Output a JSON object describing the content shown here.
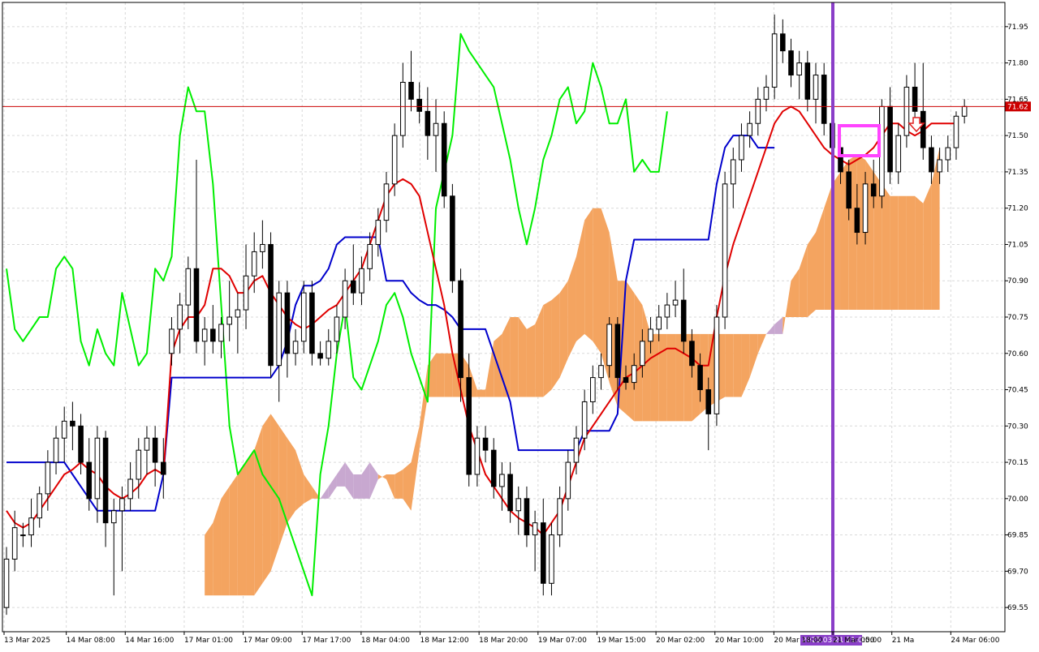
{
  "chart_data": {
    "type": "candlestick",
    "y_ticks": [
      "71.95",
      "71.80",
      "71.65",
      "71.50",
      "71.35",
      "71.20",
      "71.05",
      "70.90",
      "70.75",
      "70.60",
      "70.45",
      "70.30",
      "70.15",
      "70.00",
      "69.85",
      "69.70",
      "69.55"
    ],
    "x_ticks": [
      "13 Mar 2025",
      "14 Mar 08:00",
      "14 Mar 16:00",
      "17 Mar 01:00",
      "17 Mar 09:00",
      "17 Mar 17:00",
      "18 Mar 04:00",
      "18 Mar 12:00",
      "18 Mar 20:00",
      "19 Mar 07:00",
      "19 Mar 15:00",
      "20 Mar 02:00",
      "20 Mar 10:00",
      "20 Mar 18:00",
      "21 Mar 05:00",
      "21 Ma",
      "24 Mar 06:00"
    ],
    "time_badge": "2025.03.21 21:00",
    "time_badge_suffix": ":00",
    "current_price": "71.62",
    "grid": true,
    "price_range": [
      69.45,
      72.05
    ],
    "colors": {
      "tenkan": "#e00000",
      "kijun": "#0000cc",
      "chikou": "#00ee00",
      "chikou_overlap": "#ff5fa0",
      "cloud_bull": "#f4a460",
      "cloud_bear": "#c8a8d0",
      "bull_candle": "#ffffff",
      "bear_candle": "#000000",
      "neutral_candle": "#1f5fa0",
      "vline": "#8a3ec8",
      "price_line": "#cc0000",
      "highlight_box": "#ff44ff",
      "arrow": "#e02020"
    },
    "candles": [
      {
        "o": 69.55,
        "h": 69.8,
        "l": 69.52,
        "c": 69.75
      },
      {
        "o": 69.75,
        "h": 69.95,
        "l": 69.7,
        "c": 69.88
      },
      {
        "o": 69.85,
        "h": 69.9,
        "l": 69.8,
        "c": 69.85
      },
      {
        "o": 69.85,
        "h": 70.0,
        "l": 69.8,
        "c": 69.92
      },
      {
        "o": 69.92,
        "h": 70.05,
        "l": 69.88,
        "c": 70.02
      },
      {
        "o": 70.02,
        "h": 70.2,
        "l": 69.95,
        "c": 70.15
      },
      {
        "o": 70.15,
        "h": 70.3,
        "l": 70.1,
        "c": 70.25
      },
      {
        "o": 70.25,
        "h": 70.38,
        "l": 70.15,
        "c": 70.32
      },
      {
        "o": 70.32,
        "h": 70.4,
        "l": 70.2,
        "c": 70.3
      },
      {
        "o": 70.3,
        "h": 70.35,
        "l": 70.1,
        "c": 70.15
      },
      {
        "o": 70.15,
        "h": 70.25,
        "l": 69.95,
        "c": 70.0
      },
      {
        "o": 70.0,
        "h": 70.3,
        "l": 69.9,
        "c": 70.25
      },
      {
        "o": 70.25,
        "h": 70.28,
        "l": 69.8,
        "c": 69.9
      },
      {
        "o": 69.9,
        "h": 70.0,
        "l": 69.6,
        "c": 69.95
      },
      {
        "o": 69.95,
        "h": 70.05,
        "l": 69.7,
        "c": 70.0
      },
      {
        "o": 70.0,
        "h": 70.15,
        "l": 69.95,
        "c": 70.08
      },
      {
        "o": 70.08,
        "h": 70.25,
        "l": 70.0,
        "c": 70.2
      },
      {
        "o": 70.2,
        "h": 70.3,
        "l": 70.1,
        "c": 70.25
      },
      {
        "o": 70.25,
        "h": 70.3,
        "l": 70.05,
        "c": 70.15
      },
      {
        "o": 70.15,
        "h": 70.25,
        "l": 70.0,
        "c": 70.1
      },
      {
        "o": 70.6,
        "h": 70.75,
        "l": 70.55,
        "c": 70.7
      },
      {
        "o": 70.7,
        "h": 70.85,
        "l": 70.6,
        "c": 70.8
      },
      {
        "o": 70.8,
        "h": 71.0,
        "l": 70.7,
        "c": 70.95
      },
      {
        "o": 70.95,
        "h": 71.4,
        "l": 70.6,
        "c": 70.65
      },
      {
        "o": 70.65,
        "h": 70.75,
        "l": 70.55,
        "c": 70.7
      },
      {
        "o": 70.7,
        "h": 70.8,
        "l": 70.6,
        "c": 70.65
      },
      {
        "o": 70.65,
        "h": 70.75,
        "l": 70.58,
        "c": 70.72
      },
      {
        "o": 70.72,
        "h": 70.9,
        "l": 70.65,
        "c": 70.75
      },
      {
        "o": 70.75,
        "h": 70.85,
        "l": 70.6,
        "c": 70.78
      },
      {
        "o": 70.78,
        "h": 71.05,
        "l": 70.7,
        "c": 70.92
      },
      {
        "o": 70.92,
        "h": 71.1,
        "l": 70.85,
        "c": 71.02
      },
      {
        "o": 71.02,
        "h": 71.15,
        "l": 70.95,
        "c": 71.05
      },
      {
        "o": 71.05,
        "h": 71.1,
        "l": 70.5,
        "c": 70.55
      },
      {
        "o": 70.55,
        "h": 70.9,
        "l": 70.4,
        "c": 70.85
      },
      {
        "o": 70.85,
        "h": 70.9,
        "l": 70.5,
        "c": 70.6
      },
      {
        "o": 70.6,
        "h": 70.7,
        "l": 70.55,
        "c": 70.65
      },
      {
        "o": 70.65,
        "h": 70.9,
        "l": 70.6,
        "c": 70.85
      },
      {
        "o": 70.85,
        "h": 70.9,
        "l": 70.55,
        "c": 70.6
      },
      {
        "o": 70.6,
        "h": 70.65,
        "l": 70.55,
        "c": 70.58
      },
      {
        "o": 70.58,
        "h": 70.7,
        "l": 70.55,
        "c": 70.65
      },
      {
        "o": 70.65,
        "h": 70.8,
        "l": 70.6,
        "c": 70.75
      },
      {
        "o": 70.75,
        "h": 70.95,
        "l": 70.7,
        "c": 70.9
      },
      {
        "o": 70.9,
        "h": 71.05,
        "l": 70.8,
        "c": 70.85
      },
      {
        "o": 70.85,
        "h": 71.0,
        "l": 70.8,
        "c": 70.95
      },
      {
        "o": 70.95,
        "h": 71.1,
        "l": 70.9,
        "c": 71.05
      },
      {
        "o": 71.05,
        "h": 71.2,
        "l": 71.0,
        "c": 71.15
      },
      {
        "o": 71.15,
        "h": 71.35,
        "l": 71.1,
        "c": 71.3
      },
      {
        "o": 71.3,
        "h": 71.55,
        "l": 71.25,
        "c": 71.5
      },
      {
        "o": 71.5,
        "h": 71.8,
        "l": 71.45,
        "c": 71.72
      },
      {
        "o": 71.72,
        "h": 71.85,
        "l": 71.6,
        "c": 71.65
      },
      {
        "o": 71.65,
        "h": 71.72,
        "l": 71.55,
        "c": 71.6
      },
      {
        "o": 71.6,
        "h": 71.7,
        "l": 71.4,
        "c": 71.5
      },
      {
        "o": 71.5,
        "h": 71.65,
        "l": 71.35,
        "c": 71.55
      },
      {
        "o": 71.55,
        "h": 71.6,
        "l": 71.2,
        "c": 71.25
      },
      {
        "o": 71.25,
        "h": 71.3,
        "l": 70.85,
        "c": 70.9
      },
      {
        "o": 70.9,
        "h": 70.95,
        "l": 70.4,
        "c": 70.5
      },
      {
        "o": 70.5,
        "h": 70.6,
        "l": 70.05,
        "c": 70.1
      },
      {
        "o": 70.1,
        "h": 70.3,
        "l": 70.05,
        "c": 70.25
      },
      {
        "o": 70.25,
        "h": 70.3,
        "l": 70.15,
        "c": 70.2
      },
      {
        "o": 70.2,
        "h": 70.25,
        "l": 70.0,
        "c": 70.05
      },
      {
        "o": 70.05,
        "h": 70.15,
        "l": 69.95,
        "c": 70.1
      },
      {
        "o": 70.1,
        "h": 70.15,
        "l": 69.9,
        "c": 69.95
      },
      {
        "o": 69.95,
        "h": 70.05,
        "l": 69.85,
        "c": 70.0
      },
      {
        "o": 70.0,
        "h": 70.05,
        "l": 69.8,
        "c": 69.85
      },
      {
        "o": 69.85,
        "h": 69.95,
        "l": 69.7,
        "c": 69.9
      },
      {
        "o": 69.9,
        "h": 70.0,
        "l": 69.6,
        "c": 69.65
      },
      {
        "o": 69.65,
        "h": 69.9,
        "l": 69.6,
        "c": 69.85
      },
      {
        "o": 69.85,
        "h": 70.05,
        "l": 69.8,
        "c": 70.0
      },
      {
        "o": 70.0,
        "h": 70.2,
        "l": 69.95,
        "c": 70.15
      },
      {
        "o": 70.15,
        "h": 70.3,
        "l": 70.1,
        "c": 70.25
      },
      {
        "o": 70.25,
        "h": 70.45,
        "l": 70.2,
        "c": 70.4
      },
      {
        "o": 70.4,
        "h": 70.55,
        "l": 70.35,
        "c": 70.5
      },
      {
        "o": 70.5,
        "h": 70.6,
        "l": 70.45,
        "c": 70.55
      },
      {
        "o": 70.55,
        "h": 70.75,
        "l": 70.5,
        "c": 70.72
      },
      {
        "o": 70.72,
        "h": 70.75,
        "l": 70.45,
        "c": 70.5
      },
      {
        "o": 70.5,
        "h": 70.55,
        "l": 70.45,
        "c": 70.48
      },
      {
        "o": 70.48,
        "h": 70.6,
        "l": 70.45,
        "c": 70.55
      },
      {
        "o": 70.55,
        "h": 70.7,
        "l": 70.5,
        "c": 70.65
      },
      {
        "o": 70.65,
        "h": 70.75,
        "l": 70.6,
        "c": 70.7
      },
      {
        "o": 70.7,
        "h": 70.8,
        "l": 70.65,
        "c": 70.75
      },
      {
        "o": 70.75,
        "h": 70.85,
        "l": 70.7,
        "c": 70.8
      },
      {
        "o": 70.8,
        "h": 70.9,
        "l": 70.75,
        "c": 70.82
      },
      {
        "o": 70.82,
        "h": 70.95,
        "l": 70.6,
        "c": 70.65
      },
      {
        "o": 70.65,
        "h": 70.7,
        "l": 70.5,
        "c": 70.55
      },
      {
        "o": 70.55,
        "h": 70.6,
        "l": 70.4,
        "c": 70.45
      },
      {
        "o": 70.45,
        "h": 70.5,
        "l": 70.2,
        "c": 70.35
      },
      {
        "o": 70.35,
        "h": 70.8,
        "l": 70.3,
        "c": 70.75
      },
      {
        "o": 70.75,
        "h": 71.35,
        "l": 70.7,
        "c": 71.3
      },
      {
        "o": 71.3,
        "h": 71.45,
        "l": 71.2,
        "c": 71.4
      },
      {
        "o": 71.4,
        "h": 71.55,
        "l": 71.35,
        "c": 71.5
      },
      {
        "o": 71.5,
        "h": 71.6,
        "l": 71.45,
        "c": 71.55
      },
      {
        "o": 71.55,
        "h": 71.7,
        "l": 71.5,
        "c": 71.65
      },
      {
        "o": 71.65,
        "h": 71.75,
        "l": 71.6,
        "c": 71.7
      },
      {
        "o": 71.7,
        "h": 72.0,
        "l": 71.65,
        "c": 71.92
      },
      {
        "o": 71.92,
        "h": 71.98,
        "l": 71.8,
        "c": 71.85
      },
      {
        "o": 71.85,
        "h": 71.9,
        "l": 71.7,
        "c": 71.75
      },
      {
        "o": 71.75,
        "h": 71.85,
        "l": 71.65,
        "c": 71.8
      },
      {
        "o": 71.8,
        "h": 71.85,
        "l": 71.6,
        "c": 71.65
      },
      {
        "o": 71.65,
        "h": 71.8,
        "l": 71.55,
        "c": 71.75
      },
      {
        "o": 71.75,
        "h": 71.8,
        "l": 71.5,
        "c": 71.55
      },
      {
        "o": 71.55,
        "h": 71.65,
        "l": 71.4,
        "c": 71.45
      },
      {
        "o": 71.45,
        "h": 71.5,
        "l": 71.3,
        "c": 71.35
      },
      {
        "o": 71.35,
        "h": 71.4,
        "l": 71.15,
        "c": 71.2
      },
      {
        "o": 71.2,
        "h": 71.3,
        "l": 71.05,
        "c": 71.1
      },
      {
        "o": 71.1,
        "h": 71.35,
        "l": 71.05,
        "c": 71.3
      },
      {
        "o": 71.3,
        "h": 71.4,
        "l": 71.2,
        "c": 71.25
      },
      {
        "o": 71.25,
        "h": 71.65,
        "l": 71.2,
        "c": 71.62
      },
      {
        "o": 71.62,
        "h": 71.7,
        "l": 71.3,
        "c": 71.35
      },
      {
        "o": 71.35,
        "h": 71.55,
        "l": 71.3,
        "c": 71.5
      },
      {
        "o": 71.5,
        "h": 71.75,
        "l": 71.45,
        "c": 71.7
      },
      {
        "o": 71.7,
        "h": 71.8,
        "l": 71.55,
        "c": 71.6
      },
      {
        "o": 71.6,
        "h": 71.8,
        "l": 71.4,
        "c": 71.45
      },
      {
        "o": 71.45,
        "h": 71.5,
        "l": 71.3,
        "c": 71.35
      },
      {
        "o": 71.35,
        "h": 71.45,
        "l": 71.3,
        "c": 71.4
      },
      {
        "o": 71.4,
        "h": 71.5,
        "l": 71.35,
        "c": 71.45
      },
      {
        "o": 71.45,
        "h": 71.6,
        "l": 71.4,
        "c": 71.58
      },
      {
        "o": 71.58,
        "h": 71.65,
        "l": 71.55,
        "c": 71.62
      }
    ],
    "tenkan": [
      69.95,
      69.9,
      69.88,
      69.9,
      69.95,
      70.0,
      70.05,
      70.1,
      70.12,
      70.15,
      70.12,
      70.1,
      70.05,
      70.02,
      70.0,
      70.02,
      70.05,
      70.1,
      70.12,
      70.1,
      70.6,
      70.7,
      70.75,
      70.75,
      70.8,
      70.95,
      70.95,
      70.92,
      70.85,
      70.85,
      70.9,
      70.92,
      70.85,
      70.8,
      70.75,
      70.72,
      70.7,
      70.72,
      70.75,
      70.78,
      70.8,
      70.85,
      70.9,
      70.95,
      71.05,
      71.15,
      71.25,
      71.3,
      71.32,
      71.3,
      71.25,
      71.1,
      70.95,
      70.8,
      70.6,
      70.45,
      70.3,
      70.2,
      70.1,
      70.05,
      70.0,
      69.95,
      69.92,
      69.9,
      69.88,
      69.85,
      69.9,
      69.95,
      70.05,
      70.15,
      70.25,
      70.3,
      70.35,
      70.4,
      70.45,
      70.5,
      70.52,
      70.55,
      70.58,
      70.6,
      70.62,
      70.62,
      70.6,
      70.58,
      70.55,
      70.55,
      70.75,
      70.92,
      71.05,
      71.15,
      71.25,
      71.35,
      71.45,
      71.55,
      71.6,
      71.62,
      71.6,
      71.55,
      71.5,
      71.45,
      71.42,
      71.4,
      71.38,
      71.4,
      71.42,
      71.45,
      71.5,
      71.55,
      71.55,
      71.52,
      71.5,
      71.52,
      71.55,
      71.55,
      71.55,
      71.55
    ],
    "kijun": [
      70.15,
      70.15,
      70.15,
      70.15,
      70.15,
      70.15,
      70.15,
      70.15,
      70.1,
      70.05,
      70.0,
      69.95,
      69.95,
      69.95,
      69.95,
      69.95,
      69.95,
      69.95,
      69.95,
      70.1,
      70.5,
      70.5,
      70.5,
      70.5,
      70.5,
      70.5,
      70.5,
      70.5,
      70.5,
      70.5,
      70.5,
      70.5,
      70.5,
      70.55,
      70.65,
      70.8,
      70.88,
      70.88,
      70.9,
      70.95,
      71.05,
      71.08,
      71.08,
      71.08,
      71.08,
      71.08,
      70.9,
      70.9,
      70.9,
      70.85,
      70.82,
      70.8,
      70.8,
      70.78,
      70.75,
      70.7,
      70.7,
      70.7,
      70.7,
      70.6,
      70.5,
      70.4,
      70.2,
      70.2,
      70.2,
      70.2,
      70.2,
      70.2,
      70.2,
      70.2,
      70.28,
      70.28,
      70.28,
      70.28,
      70.35,
      70.9,
      71.07,
      71.07,
      71.07,
      71.07,
      71.07,
      71.07,
      71.07,
      71.07,
      71.07,
      71.07,
      71.3,
      71.45,
      71.5,
      71.5,
      71.5,
      71.45,
      71.45,
      71.45
    ],
    "chikou": [
      70.95,
      70.7,
      70.65,
      70.7,
      70.75,
      70.75,
      70.95,
      71.0,
      70.95,
      70.65,
      70.55,
      70.7,
      70.6,
      70.55,
      70.85,
      70.7,
      70.55,
      70.6,
      70.95,
      70.9,
      71.0,
      71.5,
      71.7,
      71.6,
      71.6,
      71.3,
      70.8,
      70.3,
      70.1,
      70.15,
      70.2,
      70.1,
      70.05,
      70.0,
      69.9,
      69.8,
      69.7,
      69.6,
      70.1,
      70.3,
      70.6,
      70.8,
      70.5,
      70.45,
      70.55,
      70.65,
      70.8,
      70.85,
      70.75,
      70.6,
      70.5,
      70.4,
      71.2,
      71.35,
      71.5,
      71.92,
      71.85,
      71.8,
      71.75,
      71.7,
      71.55,
      71.4,
      71.2,
      71.05,
      71.2,
      71.4,
      71.5,
      71.65,
      71.7,
      71.55,
      71.6,
      71.8,
      71.7,
      71.55,
      71.55,
      71.65,
      71.35,
      71.4,
      71.35,
      71.35,
      71.6
    ],
    "cloud_a": [
      69.85,
      69.9,
      70.0,
      70.05,
      70.1,
      70.15,
      70.2,
      70.3,
      70.35,
      70.3,
      70.25,
      70.2,
      70.1,
      70.05,
      70.0,
      70.0,
      70.05,
      70.05,
      70.0,
      70.0,
      70.0,
      70.08,
      70.1,
      70.1,
      70.12,
      70.15,
      70.3,
      70.55,
      70.6,
      70.6,
      70.6,
      70.6,
      70.55,
      70.45,
      70.45,
      70.65,
      70.68,
      70.75,
      70.75,
      70.7,
      70.72,
      70.8,
      70.82,
      70.85,
      70.9,
      71.0,
      71.15,
      71.2,
      71.2,
      71.1,
      70.9,
      70.9,
      70.85,
      70.8,
      70.68,
      70.68,
      70.68,
      70.68,
      70.68,
      70.68,
      70.68,
      70.68,
      70.68,
      70.68,
      70.68,
      70.68,
      70.68,
      70.68,
      70.68,
      70.68,
      70.68,
      70.9,
      70.95,
      71.05,
      71.1,
      71.2,
      71.3,
      71.35,
      71.4,
      71.42,
      71.4,
      71.35,
      71.3,
      71.25,
      71.25,
      71.25,
      71.25,
      71.22,
      71.3,
      71.45
    ],
    "cloud_b": [
      69.6,
      69.6,
      69.6,
      69.6,
      69.6,
      69.6,
      69.6,
      69.65,
      69.7,
      69.8,
      69.9,
      69.95,
      69.98,
      70.0,
      70.0,
      70.05,
      70.1,
      70.15,
      70.1,
      70.1,
      70.15,
      70.1,
      70.08,
      70.0,
      70.0,
      69.95,
      70.2,
      70.42,
      70.42,
      70.42,
      70.42,
      70.42,
      70.42,
      70.42,
      70.42,
      70.42,
      70.42,
      70.42,
      70.42,
      70.42,
      70.42,
      70.42,
      70.45,
      70.5,
      70.58,
      70.65,
      70.68,
      70.65,
      70.6,
      70.48,
      70.38,
      70.35,
      70.32,
      70.32,
      70.32,
      70.32,
      70.32,
      70.32,
      70.32,
      70.32,
      70.35,
      70.38,
      70.4,
      70.42,
      70.42,
      70.42,
      70.5,
      70.6,
      70.68,
      70.72,
      70.75,
      70.75,
      70.75,
      70.75,
      70.78,
      70.78,
      70.78,
      70.78,
      70.78,
      70.78,
      70.78,
      70.78,
      70.78,
      70.78,
      70.78,
      70.78,
      70.78,
      70.78,
      70.78,
      70.78
    ]
  }
}
